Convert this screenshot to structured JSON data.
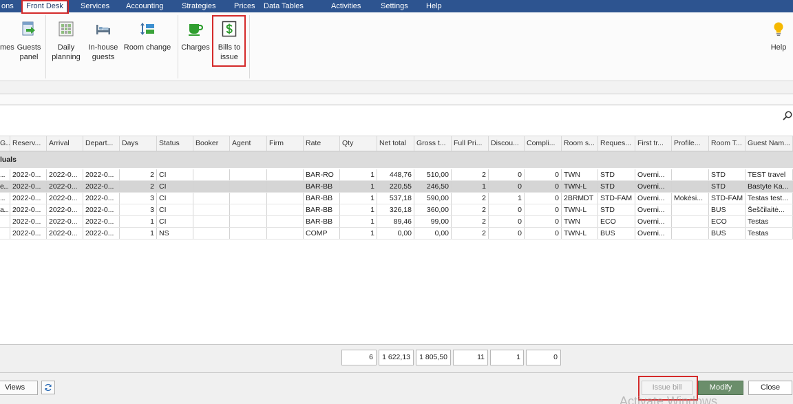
{
  "colors": {
    "menu_bar": "#2d5490",
    "selected_row": "#d5d5d5",
    "group_row": "#dcdcdc",
    "accent_green": "#6b8e6b",
    "highlight_red": "#d42a2a"
  },
  "menu": {
    "items": [
      {
        "label": "ons"
      },
      {
        "label": "Front Desk",
        "active": true
      },
      {
        "label": "Services"
      },
      {
        "label": "Accounting"
      },
      {
        "label": "Strategies"
      },
      {
        "label": "Prices"
      },
      {
        "label": "Data Tables"
      },
      {
        "label": "Activities"
      },
      {
        "label": "Settings"
      },
      {
        "label": "Help"
      }
    ]
  },
  "ribbon": {
    "cut_button": {
      "label": "mes"
    },
    "guests_panel": {
      "line1": "Guests",
      "line2": "panel",
      "icon": "guests-panel-icon"
    },
    "daily_planning": {
      "line1": "Daily",
      "line2": "planning",
      "icon": "daily-planning-icon"
    },
    "in_house_guests": {
      "line1": "In-house",
      "line2": "guests",
      "icon": "bed-icon"
    },
    "room_change": {
      "line1": "Room change",
      "icon": "room-change-icon"
    },
    "charges": {
      "line1": "Charges",
      "icon": "cup-icon"
    },
    "bills_to_issue": {
      "line1": "Bills to",
      "line2": "issue",
      "icon": "dollar-bill-icon"
    },
    "help": {
      "line1": "Help",
      "icon": "lightbulb-icon"
    }
  },
  "search": {
    "icon": "search-icon"
  },
  "grid": {
    "columns": [
      "G...",
      "Reserv...",
      "Arrival",
      "Depart...",
      "Days",
      "Status",
      "Booker",
      "Agent",
      "Firm",
      "Rate",
      "Qty",
      "Net total",
      "Gross t...",
      "Full Pri...",
      "Discou...",
      "Compli...",
      "Room s...",
      "Reques...",
      "First tr...",
      "Profile...",
      "Room T...",
      "Guest Nam..."
    ],
    "group_label": "luals",
    "selected_row": 1,
    "rows": [
      [
        "...",
        "2022-0...",
        "2022-0...",
        "2022-0...",
        "2",
        "CI",
        "",
        "",
        "",
        "BAR-RO",
        "1",
        "448,76",
        "510,00",
        "2",
        "0",
        "0",
        "TWN",
        "STD",
        "Overni...",
        "",
        "STD",
        "TEST travel"
      ],
      [
        "e...",
        "2022-0...",
        "2022-0...",
        "2022-0...",
        "2",
        "CI",
        "",
        "",
        "",
        "BAR-BB",
        "1",
        "220,55",
        "246,50",
        "1",
        "0",
        "0",
        "TWN-L",
        "STD",
        "Overni...",
        "",
        "STD",
        "Bastyte Ka..."
      ],
      [
        "...",
        "2022-0...",
        "2022-0...",
        "2022-0...",
        "3",
        "CI",
        "",
        "",
        "",
        "BAR-BB",
        "1",
        "537,18",
        "590,00",
        "2",
        "1",
        "0",
        "2BRMDT",
        "STD-FAM",
        "Overni...",
        "Mokėsi...",
        "STD-FAM",
        "Testas test..."
      ],
      [
        "a...",
        "2022-0...",
        "2022-0...",
        "2022-0...",
        "3",
        "CI",
        "",
        "",
        "",
        "BAR-BB",
        "1",
        "326,18",
        "360,00",
        "2",
        "0",
        "0",
        "TWN-L",
        "STD",
        "Overni...",
        "",
        "BUS",
        "Šeščilaitė..."
      ],
      [
        "",
        "2022-0...",
        "2022-0...",
        "2022-0...",
        "1",
        "CI",
        "",
        "",
        "",
        "BAR-BB",
        "1",
        "89,46",
        "99,00",
        "2",
        "0",
        "0",
        "TWN",
        "ECO",
        "Overni...",
        "",
        "ECO",
        "Testas"
      ],
      [
        "",
        "2022-0...",
        "2022-0...",
        "2022-0...",
        "1",
        "NS",
        "",
        "",
        "",
        "COMP",
        "1",
        "0,00",
        "0,00",
        "2",
        "0",
        "0",
        "TWN-L",
        "BUS",
        "Overni...",
        "",
        "BUS",
        "Testas"
      ]
    ],
    "totals": [
      "6",
      "1 622,13",
      "1 805,50",
      "11",
      "1",
      "0"
    ]
  },
  "footer": {
    "views_label": "Views",
    "refresh_icon": "refresh-icon",
    "issue_bill_label": "Issue bill",
    "modify_label": "Modify",
    "close_label": "Close"
  },
  "watermark": "Activate Windows"
}
